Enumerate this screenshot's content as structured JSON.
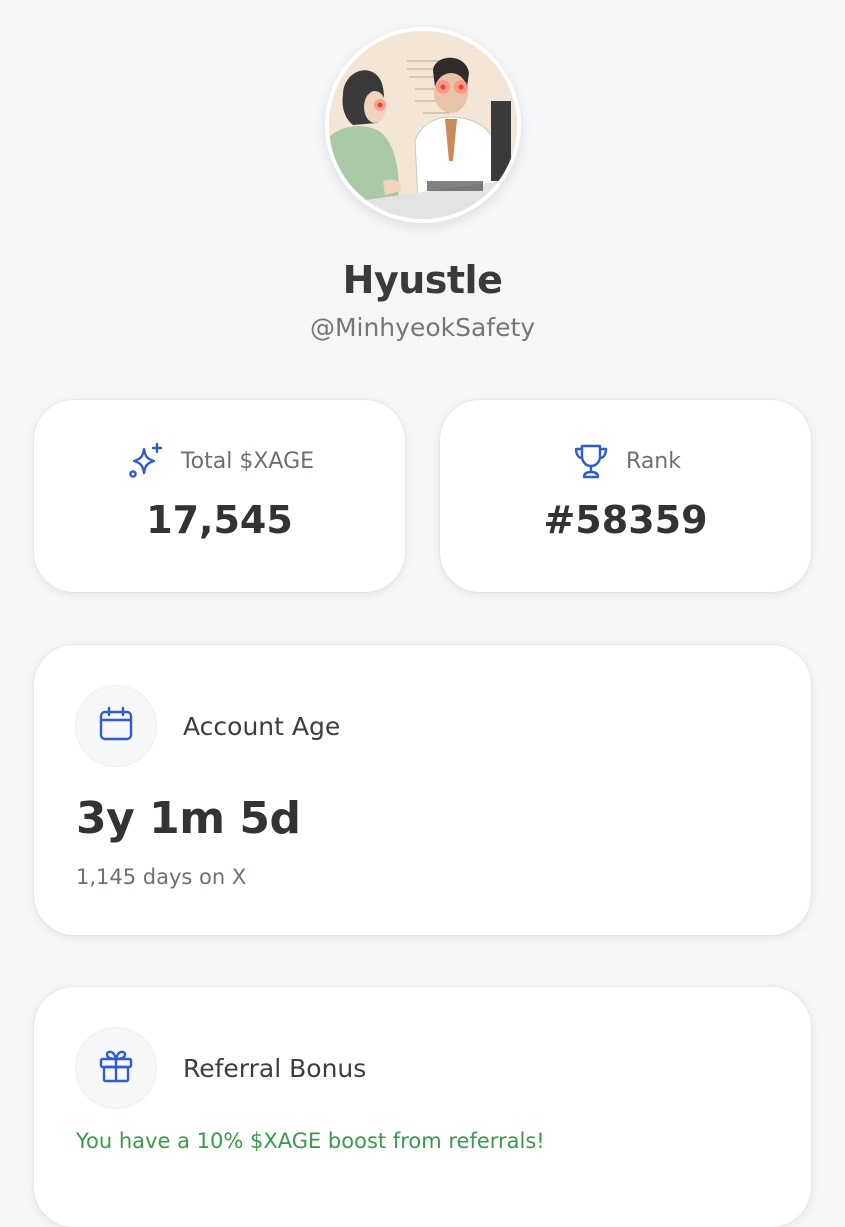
{
  "profile": {
    "avatar_label": "",
    "display_name": "Hyustle",
    "handle": "@MinhyeokSafety"
  },
  "stats": {
    "total": {
      "icon": "sparkles-icon",
      "label": "Total $XAGE",
      "value": "17,545"
    },
    "rank": {
      "icon": "trophy-icon",
      "label": "Rank",
      "value": "#58359"
    }
  },
  "account_age": {
    "icon": "calendar-icon",
    "title": "Account Age",
    "value": "3y 1m 5d",
    "subtitle": "1,145 days on X"
  },
  "referral": {
    "icon": "gift-icon",
    "title": "Referral Bonus",
    "text": "You have a 10% $XAGE boost from referrals!"
  },
  "colors": {
    "background": "#f5f6f8",
    "accent_blue": "#2f5bd3",
    "success_green": "#3b9a4a"
  }
}
